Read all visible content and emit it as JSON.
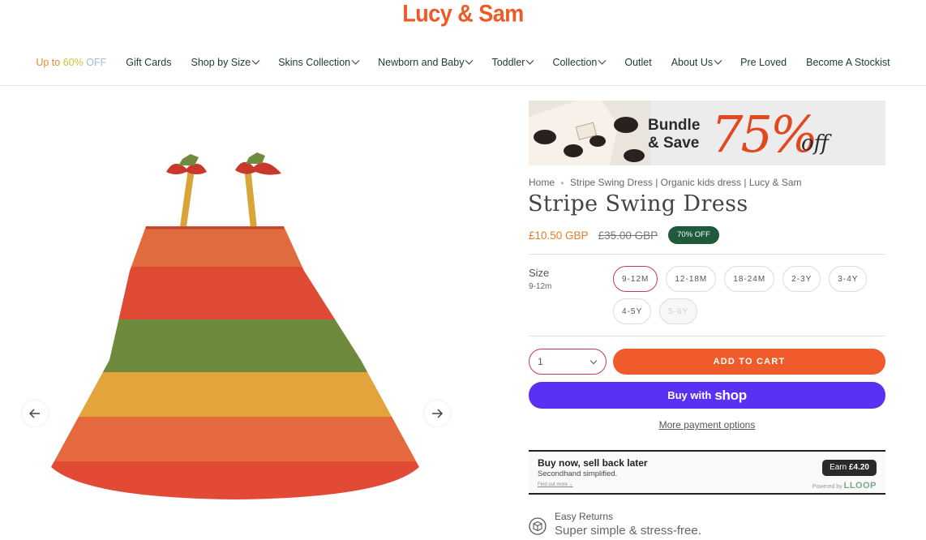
{
  "brand": {
    "name": "Lucy & Sam"
  },
  "nav": {
    "sale": {
      "prefix": "Up to",
      "pct": "60%",
      "suffix": "OFF"
    },
    "items": [
      {
        "label": "Gift Cards",
        "dropdown": false
      },
      {
        "label": "Shop by Size",
        "dropdown": true
      },
      {
        "label": "Skins Collection",
        "dropdown": true
      },
      {
        "label": "Newborn and Baby",
        "dropdown": true
      },
      {
        "label": "Toddler",
        "dropdown": true
      },
      {
        "label": "Collection",
        "dropdown": true
      },
      {
        "label": "Outlet",
        "dropdown": false
      },
      {
        "label": "About Us",
        "dropdown": true
      },
      {
        "label": "Pre Loved",
        "dropdown": false
      },
      {
        "label": "Become A Stockist",
        "dropdown": false
      }
    ]
  },
  "gallery": {
    "prev_icon": "arrow-left-icon",
    "next_icon": "arrow-right-icon"
  },
  "banner": {
    "line1": "Bundle",
    "line2": "& Save",
    "percent": "75%",
    "off": "off"
  },
  "breadcrumb": {
    "home": "Home",
    "current": "Stripe Swing Dress | Organic kids dress | Lucy & Sam"
  },
  "product": {
    "title": "Stripe Swing Dress",
    "price": "£10.50 GBP",
    "compare_price": "£35.00 GBP",
    "discount_badge": "70% OFF"
  },
  "size": {
    "label": "Size",
    "selected_value": "9-12m",
    "options": [
      {
        "label": "9-12M",
        "state": "selected"
      },
      {
        "label": "12-18M",
        "state": "available"
      },
      {
        "label": "18-24M",
        "state": "available"
      },
      {
        "label": "2-3Y",
        "state": "available"
      },
      {
        "label": "3-4Y",
        "state": "available"
      },
      {
        "label": "4-5Y",
        "state": "available"
      },
      {
        "label": "5-6Y",
        "state": "disabled"
      }
    ]
  },
  "cart": {
    "quantity": "1",
    "add_to_cart": "ADD TO CART",
    "buy_with": "Buy with",
    "shop_brand": "shop",
    "more_payment": "More payment options"
  },
  "loop": {
    "heading": "Buy now, sell back later",
    "subheading": "Secondhand simplified.",
    "find_out": "Find out more",
    "earn_label": "Earn",
    "earn_amount": "£4.20",
    "powered_by": "Powered by",
    "powered_brand": "LLOOP"
  },
  "returns": {
    "title": "Easy Returns",
    "subtitle": "Super simple & stress-free."
  },
  "colors": {
    "brand_orange": "#ee5a26",
    "cart_button": "#ef5b2a",
    "shop_pay": "#5a31f4",
    "badge_green": "#1f5a3d",
    "price": "#e77c25",
    "selected_border": "#c43a56"
  }
}
